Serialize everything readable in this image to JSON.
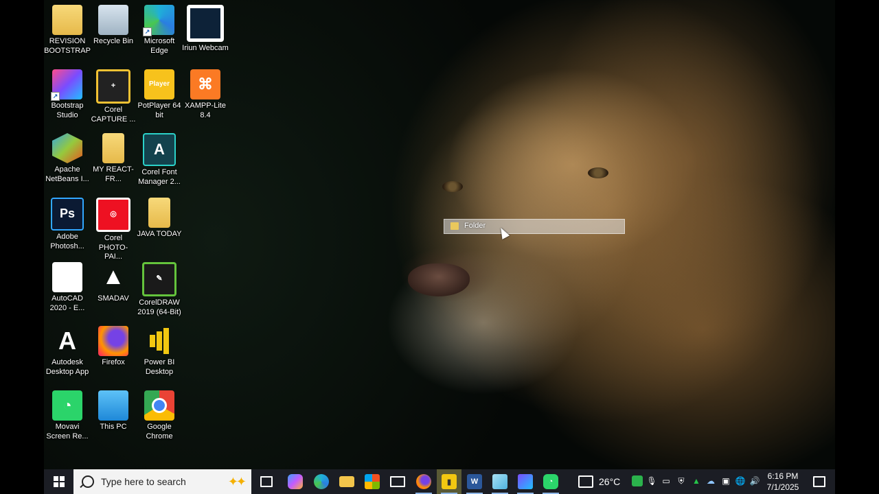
{
  "desktop": {
    "icons": [
      {
        "label": "REVISION BOOTSTRAP",
        "icon": "chrome-folder-icon"
      },
      {
        "label": "Recycle Bin",
        "icon": "recycle-bin-icon"
      },
      {
        "label": "Microsoft Edge",
        "icon": "edge-icon"
      },
      {
        "label": "Iriun Webcam",
        "icon": "iriun-icon"
      },
      {
        "label": "Bootstrap Studio",
        "icon": "bootstrap-studio-icon"
      },
      {
        "label": "Corel CAPTURE ...",
        "icon": "corel-capture-icon"
      },
      {
        "label": "PotPlayer 64 bit",
        "icon": "potplayer-icon",
        "glyph": "Player"
      },
      {
        "label": "XAMPP-Lite 8.4",
        "icon": "xampp-icon",
        "glyph": "⌘"
      },
      {
        "label": "Apache NetBeans I...",
        "icon": "netbeans-icon"
      },
      {
        "label": "MY REACT-FR...",
        "icon": "folder-icon"
      },
      {
        "label": "Corel Font Manager 2...",
        "icon": "corel-font-manager-icon",
        "glyph": "A"
      },
      {
        "label": "Adobe Photosh...",
        "icon": "photoshop-icon",
        "glyph": "Ps"
      },
      {
        "label": "Corel PHOTO-PAI...",
        "icon": "corel-photo-paint-icon"
      },
      {
        "label": "JAVA TODAY",
        "icon": "folder-icon"
      },
      {
        "label": "AutoCAD 2020 - E...",
        "icon": "autocad-icon",
        "glyph": "A"
      },
      {
        "label": "SMADAV",
        "icon": "smadav-icon",
        "glyph": "▲"
      },
      {
        "label": "CorelDRAW 2019 (64-Bit)",
        "icon": "coreldraw-icon"
      },
      {
        "label": "Autodesk Desktop App",
        "icon": "autodesk-icon",
        "glyph": "A"
      },
      {
        "label": "Firefox",
        "icon": "firefox-icon"
      },
      {
        "label": "Power BI Desktop",
        "icon": "powerbi-icon"
      },
      {
        "label": "Movavi Screen Re...",
        "icon": "movavi-icon",
        "glyph": "◔"
      },
      {
        "label": "This PC",
        "icon": "this-pc-icon"
      },
      {
        "label": "Google Chrome",
        "icon": "chrome-icon"
      }
    ],
    "drag_label": "Folder"
  },
  "taskbar": {
    "search_placeholder": "Type here to search",
    "weather": "26°C",
    "time": "6:16 PM",
    "date": "7/1/2025",
    "colors": {
      "background": "#1b1d24",
      "search": "#f3f3f3",
      "active_indicator": "#8fb7e8"
    }
  }
}
